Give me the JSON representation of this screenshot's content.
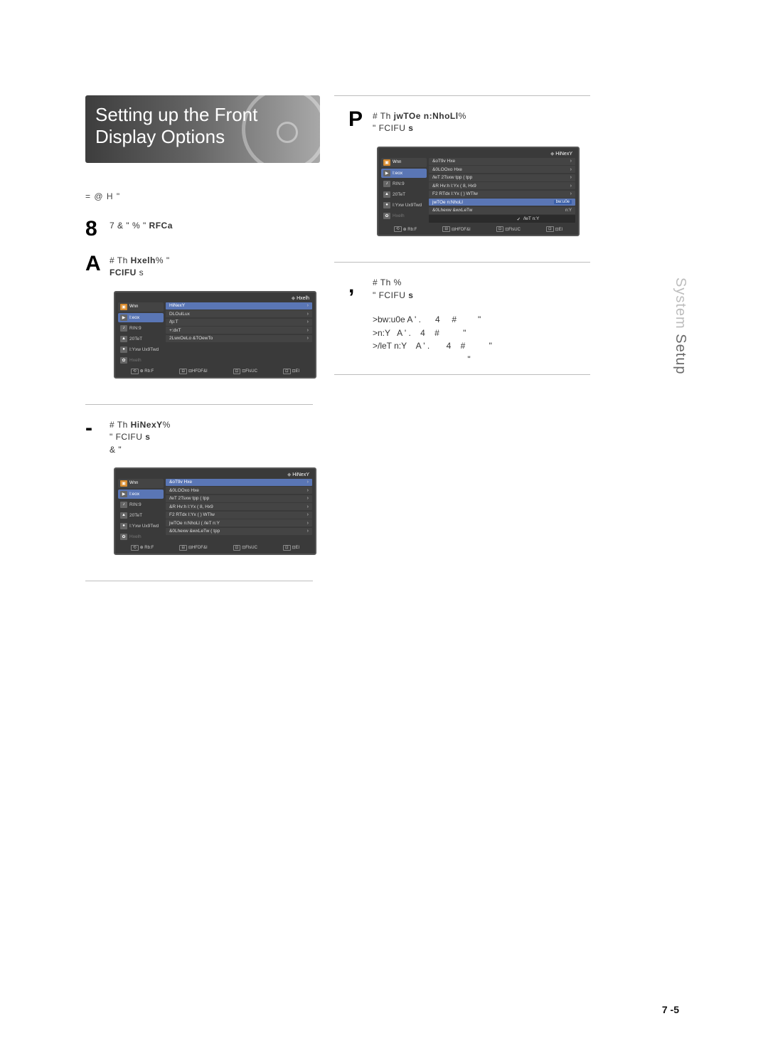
{
  "heading": "Setting up the Front Display Options",
  "intro": "=      @                       H      \"",
  "side_tab_light": "System",
  "side_tab_dark": " Setup",
  "page_number": "7 -5",
  "left": {
    "step1": {
      "num": "8",
      "text": "7         & \"   % \"                     ",
      "bold": "RFCa"
    },
    "step2": {
      "num": "A",
      "prefix": "#            Th                          ",
      "bold": "Hxelh",
      "suffix": "%     \"",
      "line2a": "FCIFU",
      "line2b": "     s"
    },
    "osd1": {
      "crumb": "Hxelh",
      "nav_header": "Wnn",
      "nav": [
        {
          "icon": "▶",
          "label": "I:eox",
          "sel": true
        },
        {
          "icon": "♪",
          "label": "RIN:9"
        },
        {
          "icon": "▲",
          "label": "20TeT"
        },
        {
          "icon": "●",
          "label": "I:Yxw Ux9Twd"
        },
        {
          "icon": "✿",
          "label": "Hxelh",
          "dim": true
        }
      ],
      "rows": [
        {
          "label": "HiNexY",
          "arrow": true,
          "hl": true
        },
        {
          "label": "DLOulLux",
          "arrow": true
        },
        {
          "label": "/lp:T",
          "arrow": true
        },
        {
          "label": "+:dxT",
          "arrow": true
        },
        {
          "label": "2LwxOeLo &TOewTo",
          "arrow": true
        }
      ],
      "foot": [
        "⊕ Rb:F",
        "⊟HFDF&I",
        "⊡FlsUC",
        "⊡El"
      ]
    },
    "step3": {
      "num": "-",
      "prefix": "#            Th                          ",
      "bold": "HiNexY",
      "suffix": "%",
      "line2a": "\"         FCIFU",
      "line2b": "     s",
      "line3": "&                  \""
    },
    "osd2": {
      "crumb": "HiNexY",
      "nav_header": "Wnn",
      "nav": [
        {
          "icon": "▶",
          "label": "I:eox",
          "sel": true
        },
        {
          "icon": "♪",
          "label": "RIN:9"
        },
        {
          "icon": "▲",
          "label": "20TeT"
        },
        {
          "icon": "●",
          "label": "I:Yxw Ux9Twd"
        },
        {
          "icon": "✿",
          "label": "Hxelh",
          "dim": true
        }
      ],
      "rows": [
        {
          "label": "&oT9v Hxe",
          "arrow": true,
          "hl": true
        },
        {
          "label": "&0LOOxo Hxe",
          "arrow": true
        },
        {
          "label": "/leT 2Tsxw tpp   ( tpp",
          "arrow": true
        },
        {
          "label": "&R Hv:h I:Yx      ( 8, Hx9",
          "arrow": true
        },
        {
          "label": "F2 RTdx I:Yx     ( ) WTlw",
          "arrow": true
        },
        {
          "label": "jwTOe n:NhoLl    ( /leT n:Y",
          "arrow": true
        },
        {
          "label": "&0Lhexw &wxLeTw  ( tpp",
          "arrow": true
        }
      ],
      "foot": [
        "⊕ Rb:F",
        "⊟HFDF&I",
        "⊡FlsUC",
        "⊡El"
      ]
    }
  },
  "right": {
    "step4": {
      "num": "P",
      "prefix": "#            Th                          ",
      "bold": "jwTOe n:NhoLl",
      "suffix": "%",
      "line2a": "\"         FCIFU",
      "line2b": "     s"
    },
    "osd3": {
      "crumb": "HiNexY",
      "nav_header": "Wnn",
      "nav": [
        {
          "icon": "▶",
          "label": "I:eox",
          "sel": true
        },
        {
          "icon": "♪",
          "label": "RIN:9"
        },
        {
          "icon": "▲",
          "label": "20TeT"
        },
        {
          "icon": "●",
          "label": "I:Yxw Ux9Twd"
        },
        {
          "icon": "✿",
          "label": "Hxelh",
          "dim": true
        }
      ],
      "rows": [
        {
          "label": "&oT9v Hxe",
          "arrow": true
        },
        {
          "label": "&0LOOxo Hxe",
          "arrow": true
        },
        {
          "label": "/leT 2Tsxw tpp   ( tpp",
          "arrow": true
        },
        {
          "label": "&R Hv:h I:Yx      ( 8, Hx9",
          "arrow": true
        },
        {
          "label": "F2 RTdx I:Yx     ( ) WTlw",
          "arrow": true
        },
        {
          "label": "jwTOe n:NhoLl",
          "val_sel": "bw:u0e",
          "hl": true
        },
        {
          "label": "&0Lhexw &wxLeTw",
          "val": "n:Y"
        },
        {
          "dropdown": true,
          "opt": "/leT n:Y",
          "checked": true
        }
      ],
      "foot": [
        "⊕ Rb:F",
        "⊟HFDF&I",
        "⊡FlsUC",
        "⊡El"
      ]
    },
    "step5": {
      "num": ",",
      "line1": "#            Th                                %",
      "line2a": "\"         FCIFU",
      "line2b": "     s",
      "bullets": [
        ">bw:u0e A ' .      4     #         \"",
        ">n:Y   A ' .    4    #          \"",
        ">/leT n:Y    A ' .       4    #          \"",
        "                                        \""
      ]
    }
  }
}
